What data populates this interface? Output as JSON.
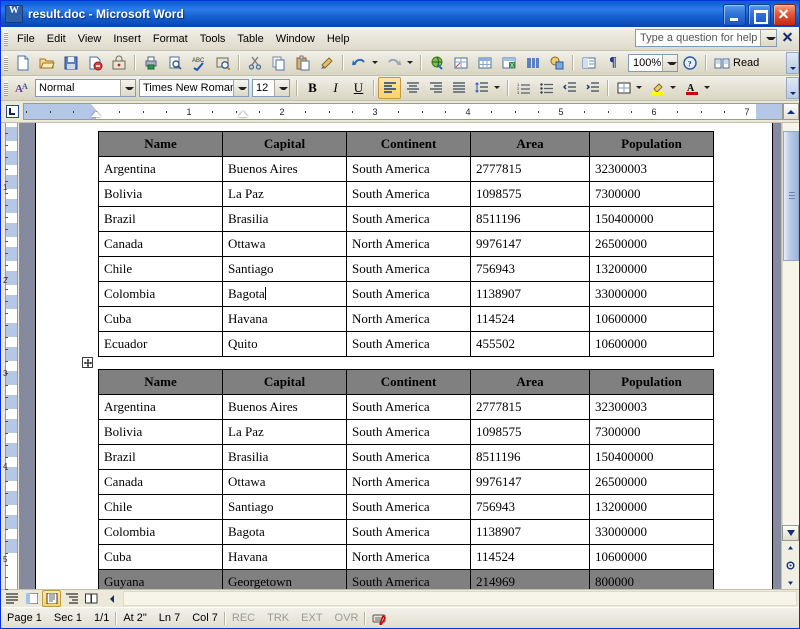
{
  "window": {
    "title": "result.doc - Microsoft Word",
    "app_icon": "word-document-icon",
    "minimize_label": "Minimize",
    "maximize_label": "Maximize",
    "close_label": "Close"
  },
  "menubar": {
    "items": [
      {
        "label": "File"
      },
      {
        "label": "Edit"
      },
      {
        "label": "View"
      },
      {
        "label": "Insert"
      },
      {
        "label": "Format"
      },
      {
        "label": "Tools"
      },
      {
        "label": "Table"
      },
      {
        "label": "Window"
      },
      {
        "label": "Help"
      }
    ],
    "help_search": {
      "placeholder": "Type a question for help",
      "value": ""
    }
  },
  "standard_toolbar": {
    "buttons": [
      {
        "name": "new-document-icon"
      },
      {
        "name": "open-icon"
      },
      {
        "name": "save-icon"
      },
      {
        "name": "mail-recipient-icon"
      },
      {
        "name": "permission-icon"
      },
      {
        "name": "print-icon"
      },
      {
        "name": "print-preview-icon"
      },
      {
        "name": "spelling-grammar-icon"
      },
      {
        "name": "research-icon"
      },
      {
        "name": "cut-icon"
      },
      {
        "name": "copy-icon"
      },
      {
        "name": "paste-icon"
      },
      {
        "name": "format-painter-icon"
      },
      {
        "name": "undo-icon"
      },
      {
        "name": "redo-icon"
      },
      {
        "name": "insert-hyperlink-icon"
      },
      {
        "name": "tables-borders-icon"
      },
      {
        "name": "insert-table-icon"
      },
      {
        "name": "insert-excel-sheet-icon"
      },
      {
        "name": "columns-icon"
      },
      {
        "name": "drawing-icon"
      },
      {
        "name": "document-map-icon"
      },
      {
        "name": "show-formatting-marks-icon"
      }
    ],
    "zoom": {
      "value": "100%",
      "label": "Zoom"
    },
    "help_button": "help-icon",
    "read_button": {
      "label": "Read",
      "icon": "read-book-icon"
    },
    "overflow_label": "Toolbar Options"
  },
  "formatting_toolbar": {
    "styles_icon": "styles-and-formatting-icon",
    "style": {
      "value": "Normal",
      "label": "Style"
    },
    "font": {
      "value": "Times New Roman",
      "label": "Font"
    },
    "size": {
      "value": "12",
      "label": "Font Size"
    },
    "buttons": [
      {
        "name": "bold-button",
        "label": "B",
        "active": false
      },
      {
        "name": "italic-button",
        "label": "I",
        "active": false
      },
      {
        "name": "underline-button",
        "label": "U",
        "active": false
      },
      {
        "name": "align-left-button",
        "active": true
      },
      {
        "name": "align-center-button",
        "active": false
      },
      {
        "name": "align-right-button",
        "active": false
      },
      {
        "name": "justify-button",
        "active": false
      },
      {
        "name": "line-spacing-button",
        "active": false
      },
      {
        "name": "numbered-list-button",
        "active": false
      },
      {
        "name": "bulleted-list-button",
        "active": false
      },
      {
        "name": "decrease-indent-button",
        "active": false
      },
      {
        "name": "increase-indent-button",
        "active": false
      },
      {
        "name": "borders-button",
        "active": false
      },
      {
        "name": "highlight-button",
        "active": false
      },
      {
        "name": "font-color-button",
        "active": false
      }
    ],
    "overflow_label": "Toolbar Options"
  },
  "ruler": {
    "tab_selector": "left-tab-stop",
    "unit": "inch",
    "marks": [
      "1",
      "2",
      "3",
      "4",
      "5",
      "6",
      "7"
    ],
    "vertical_marks": [
      "1",
      "2",
      "3",
      "4",
      "5"
    ]
  },
  "document": {
    "table_move_handle": "⊕",
    "tables": [
      {
        "name": "countries-table-1",
        "headers": [
          "Name",
          "Capital",
          "Continent",
          "Area",
          "Population"
        ],
        "rows": [
          [
            "Argentina",
            "Buenos Aires",
            "South America",
            "2777815",
            "32300003"
          ],
          [
            "Bolivia",
            "La Paz",
            "South America",
            "1098575",
            "7300000"
          ],
          [
            "Brazil",
            "Brasilia",
            "South America",
            "8511196",
            "150400000"
          ],
          [
            "Canada",
            "Ottawa",
            "North America",
            "9976147",
            "26500000"
          ],
          [
            "Chile",
            "Santiago",
            "South America",
            "756943",
            "13200000"
          ],
          [
            "Colombia",
            "Bagota",
            "South America",
            "1138907",
            "33000000"
          ],
          [
            "Cuba",
            "Havana",
            "North America",
            "114524",
            "10600000"
          ],
          [
            "Ecuador",
            "Quito",
            "South America",
            "455502",
            "10600000"
          ]
        ],
        "caret_row": 5,
        "caret_col": 1,
        "shaded_rows": []
      },
      {
        "name": "countries-table-2",
        "headers": [
          "Name",
          "Capital",
          "Continent",
          "Area",
          "Population"
        ],
        "rows": [
          [
            "Argentina",
            "Buenos Aires",
            "South America",
            "2777815",
            "32300003"
          ],
          [
            "Bolivia",
            "La Paz",
            "South America",
            "1098575",
            "7300000"
          ],
          [
            "Brazil",
            "Brasilia",
            "South America",
            "8511196",
            "150400000"
          ],
          [
            "Canada",
            "Ottawa",
            "North America",
            "9976147",
            "26500000"
          ],
          [
            "Chile",
            "Santiago",
            "South America",
            "756943",
            "13200000"
          ],
          [
            "Colombia",
            "Bagota",
            "South America",
            "1138907",
            "33000000"
          ],
          [
            "Cuba",
            "Havana",
            "North America",
            "114524",
            "10600000"
          ],
          [
            "Guyana",
            "Georgetown",
            "South America",
            "214969",
            "800000"
          ]
        ],
        "caret_row": -1,
        "caret_col": -1,
        "shaded_rows": [
          7
        ]
      }
    ]
  },
  "view_buttons": [
    {
      "name": "normal-view-button",
      "active": false
    },
    {
      "name": "web-layout-view-button",
      "active": false
    },
    {
      "name": "print-layout-view-button",
      "active": true
    },
    {
      "name": "outline-view-button",
      "active": false
    },
    {
      "name": "reading-layout-view-button",
      "active": false
    }
  ],
  "statusbar": {
    "page": "Page 1",
    "section": "Sec 1",
    "pages": "1/1",
    "at": "At 2\"",
    "line": "Ln 7",
    "column": "Col 7",
    "rec": "REC",
    "trk": "TRK",
    "ext": "EXT",
    "ovr": "OVR",
    "language_icon": "spelling-status-icon"
  },
  "colors": {
    "titlebar": "#0a5fd6",
    "header_fill": "#808080",
    "page_background": "#868a9e",
    "ruler_margin": "#b4c7e7",
    "toolbar": "#ece9d8"
  }
}
